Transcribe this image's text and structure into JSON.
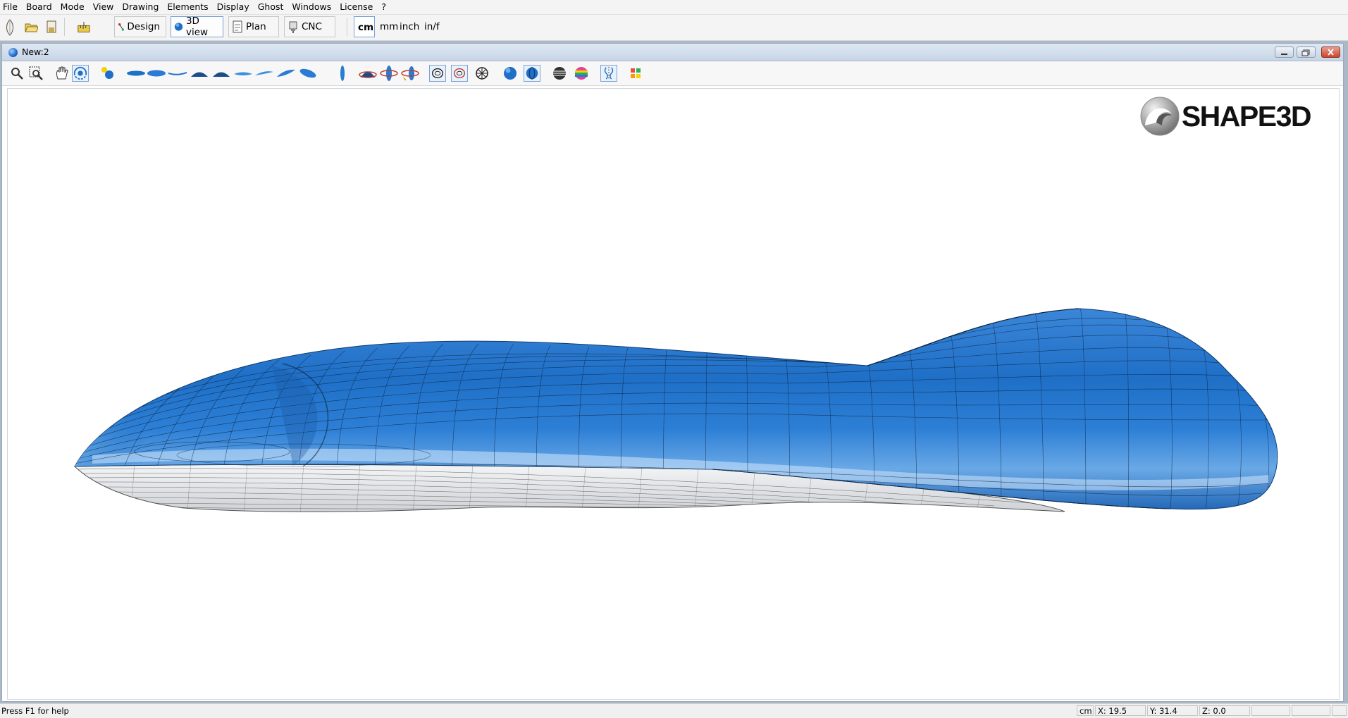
{
  "menu": [
    "File",
    "Board",
    "Mode",
    "View",
    "Drawing",
    "Elements",
    "Display",
    "Ghost",
    "Windows",
    "License",
    "?"
  ],
  "modes": {
    "design": "Design",
    "view3d": "3D view",
    "plan": "Plan",
    "cnc": "CNC"
  },
  "units": [
    "cm",
    "mm",
    "inch",
    "in/f"
  ],
  "active_unit": "cm",
  "document": {
    "title": "New:2"
  },
  "brand": "SHAPE3D",
  "colors": {
    "board_top": "#1f6fc7",
    "board_bottom": "#e9eaec",
    "accent": "#7ca1d6"
  },
  "status": {
    "help": "Press F1 for help",
    "unit": "cm",
    "x": "X: 19.5",
    "y": "Y: 31.4",
    "z": "Z: 0.0"
  }
}
